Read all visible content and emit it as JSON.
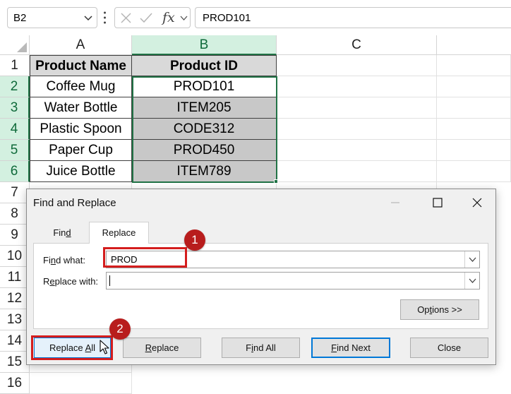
{
  "formula_bar": {
    "name_box": "B2",
    "fx_label": "fx",
    "formula_value": "PROD101"
  },
  "columns": [
    "A",
    "B",
    "C"
  ],
  "rows": [
    "1",
    "2",
    "3",
    "4",
    "5",
    "6",
    "7",
    "8",
    "9",
    "10",
    "11",
    "12",
    "13",
    "14",
    "15",
    "16"
  ],
  "table": {
    "headers": [
      "Product Name",
      "Product ID"
    ],
    "rows": [
      [
        "Coffee Mug",
        "PROD101"
      ],
      [
        "Water Bottle",
        "ITEM205"
      ],
      [
        "Plastic Spoon",
        "CODE312"
      ],
      [
        "Paper Cup",
        "PROD450"
      ],
      [
        "Juice Bottle",
        "ITEM789"
      ]
    ]
  },
  "dialog": {
    "title": "Find and Replace",
    "tabs": {
      "find": "Find",
      "replace": "Replace"
    },
    "find_what_label": "Find what:",
    "find_what_value": "PROD",
    "replace_with_label": "Replace with:",
    "replace_with_value": "",
    "options_button": "Options >>",
    "buttons": {
      "replace_all": "Replace All",
      "replace": "Replace",
      "find_all": "Find All",
      "find_next": "Find Next",
      "close": "Close"
    }
  },
  "annotations": {
    "step1": "1",
    "step2": "2",
    "color": "#d41d1d"
  },
  "colors": {
    "selection_green": "#217346",
    "header_fill": "#d9d9d9",
    "shade_fill": "#c8c8c8"
  }
}
